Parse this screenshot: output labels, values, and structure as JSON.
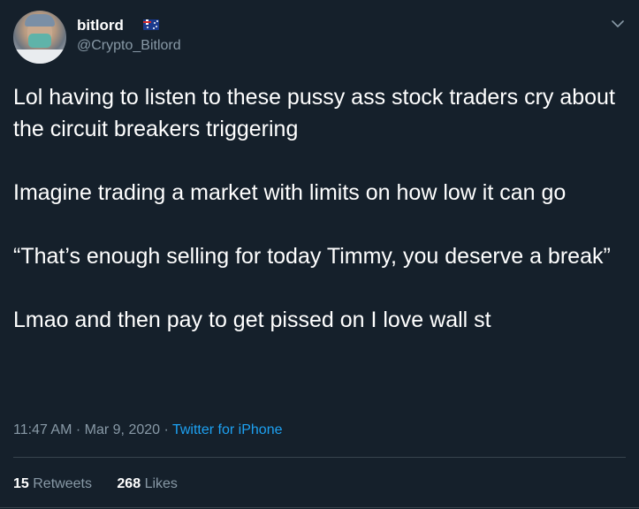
{
  "author": {
    "display_name": "bitlord",
    "flag_icon": "australia-flag-icon",
    "handle": "@Crypto_Bitlord",
    "avatar_icon": "avatar-icon"
  },
  "menu_icon": "chevron-down-icon",
  "tweet": {
    "paragraphs": [
      "Lol having to listen to these pussy ass stock traders cry about the circuit breakers triggering",
      "Imagine trading a market with limits on how low it can go",
      "“That’s enough selling for today Timmy, you deserve a break”",
      "Lmao and then pay to get pissed on I love wall st"
    ]
  },
  "meta": {
    "time": "11:47 AM",
    "separator": "·",
    "date": "Mar 9, 2020",
    "source": "Twitter for iPhone"
  },
  "stats": {
    "retweets_count": "15",
    "retweets_label": "Retweets",
    "likes_count": "268",
    "likes_label": "Likes"
  },
  "colors": {
    "background": "#15202b",
    "text": "#ffffff",
    "secondary_text": "#8899a6",
    "link": "#1da1f2",
    "divider": "#38444d"
  }
}
